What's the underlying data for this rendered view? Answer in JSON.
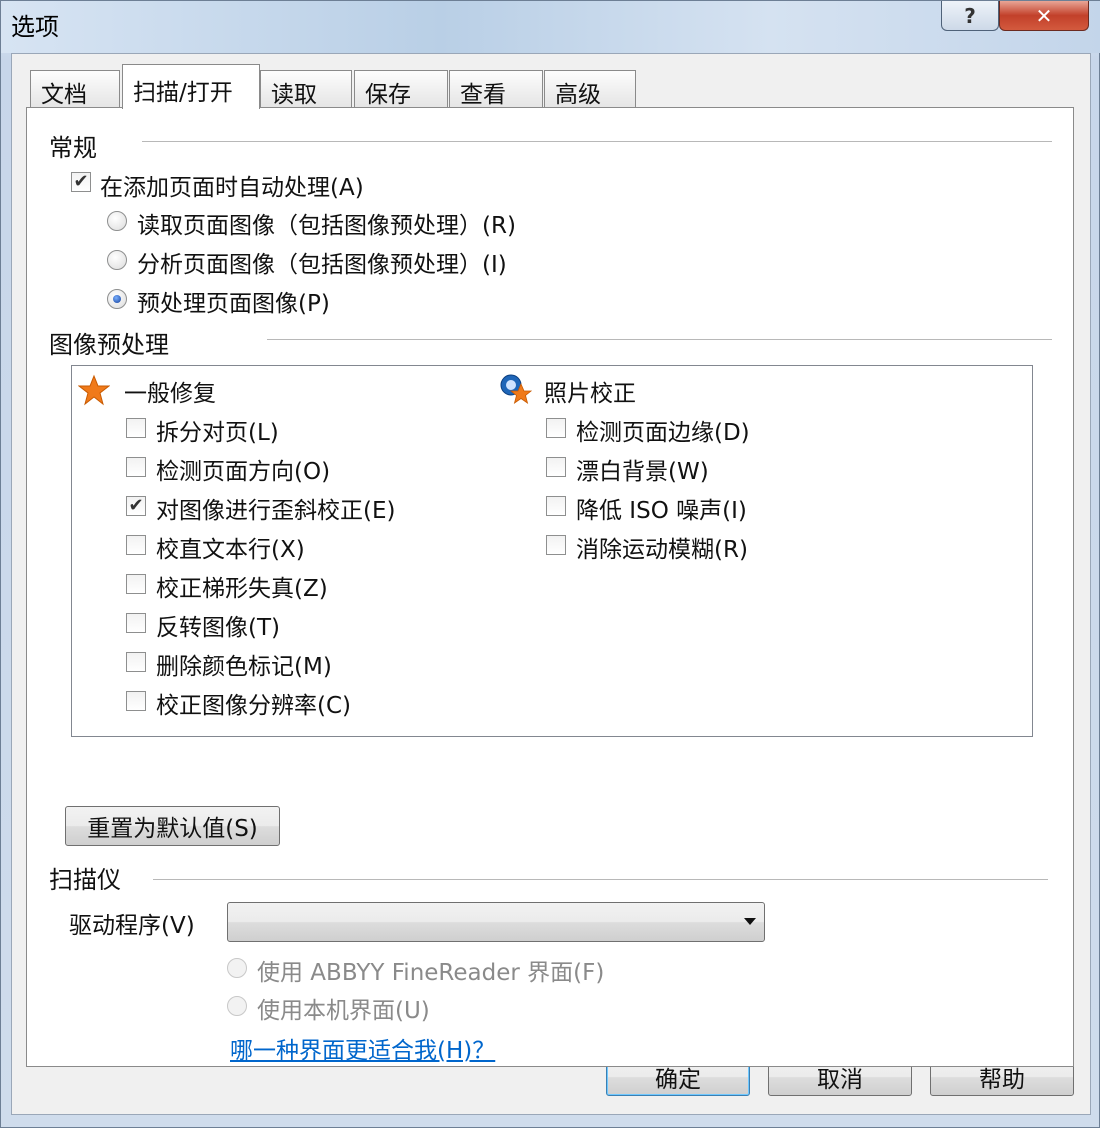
{
  "window": {
    "title": "选项",
    "help_glyph": "?",
    "close_glyph": "✕"
  },
  "tabs": [
    {
      "label": "文档",
      "active": false
    },
    {
      "label": "扫描/打开",
      "active": true
    },
    {
      "label": "读取",
      "active": false
    },
    {
      "label": "保存",
      "active": false
    },
    {
      "label": "查看",
      "active": false
    },
    {
      "label": "高级",
      "active": false
    }
  ],
  "general": {
    "title": "常规",
    "auto_process": {
      "label": "在添加页面时自动处理(A)",
      "checked": true
    },
    "options": [
      {
        "label": "读取页面图像（包括图像预处理）(R)",
        "selected": false
      },
      {
        "label": "分析页面图像（包括图像预处理）(I)",
        "selected": false
      },
      {
        "label": "预处理页面图像(P)",
        "selected": true
      }
    ]
  },
  "preprocess": {
    "title": "图像预处理",
    "general_fix": {
      "title": "一般修复",
      "icon": "star-icon",
      "items": [
        {
          "label": "拆分对页(L)",
          "checked": false
        },
        {
          "label": "检测页面方向(O)",
          "checked": false
        },
        {
          "label": "对图像进行歪斜校正(E)",
          "checked": true
        },
        {
          "label": "校直文本行(X)",
          "checked": false
        },
        {
          "label": "校正梯形失真(Z)",
          "checked": false
        },
        {
          "label": "反转图像(T)",
          "checked": false
        },
        {
          "label": "删除颜色标记(M)",
          "checked": false
        },
        {
          "label": "校正图像分辨率(C)",
          "checked": false
        }
      ]
    },
    "photo_fix": {
      "title": "照片校正",
      "icon": "photo-correction-icon",
      "items": [
        {
          "label": "检测页面边缘(D)",
          "checked": false
        },
        {
          "label": "漂白背景(W)",
          "checked": false
        },
        {
          "label": "降低 ISO 噪声(I)",
          "checked": false
        },
        {
          "label": "消除运动模糊(R)",
          "checked": false
        }
      ]
    },
    "reset_label": "重置为默认值(S)"
  },
  "scanner": {
    "title": "扫描仪",
    "driver_label": "驱动程序(V)",
    "driver_value": "",
    "options": [
      {
        "label": "使用 ABBYY FineReader 界面(F)",
        "selected": false,
        "disabled": true
      },
      {
        "label": "使用本机界面(U)",
        "selected": false,
        "disabled": true
      }
    ],
    "help_link": "哪一种界面更适合我(H)？"
  },
  "footer": {
    "ok_label": "确定",
    "cancel_label": "取消",
    "help_label": "帮助"
  },
  "colors": {
    "accent_star": "#f07a1a",
    "link": "#0066cc"
  }
}
